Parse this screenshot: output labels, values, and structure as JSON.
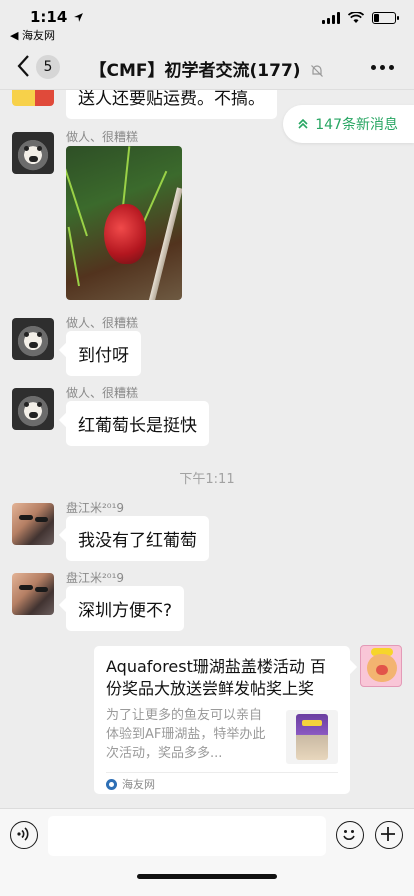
{
  "status_bar": {
    "time": "1:14",
    "back_app": "◀ 海友网"
  },
  "nav": {
    "unread_count": "5",
    "title": "【CMF】初学者交流(177)"
  },
  "new_messages": "147条新消息",
  "messages": [
    {
      "text": "送人还要贴运费。不搞。"
    },
    {
      "sender": "做人、很糟糕",
      "type": "image"
    },
    {
      "sender": "做人、很糟糕",
      "text": "到付呀"
    },
    {
      "sender": "做人、很糟糕",
      "text": "红葡萄长是挺快"
    },
    {
      "sender": "盘江米²⁰¹9",
      "text": "我没有了红葡萄"
    },
    {
      "sender": "盘江米²⁰¹9",
      "text": "深圳方便不?"
    }
  ],
  "time_separator": "下午1:11",
  "link_card": {
    "title": "Aquaforest珊湖盐盖楼活动 百份奖品大放送尝鲜发帖奖上奖",
    "description": "为了让更多的鱼友可以亲自体验到AF珊湖盐，特举办此次活动，奖品多多...",
    "source": "海友网"
  },
  "colors": {
    "background": "#ededed",
    "accent_green": "#28a663",
    "bubble": "#ffffff"
  },
  "icons": [
    "back-chevron-icon",
    "mute-bell-icon",
    "more-dots-icon",
    "double-chevron-up-icon",
    "voice-icon",
    "emoji-icon",
    "plus-icon",
    "wifi-icon",
    "signal-icon",
    "battery-icon",
    "location-arrow-icon"
  ]
}
